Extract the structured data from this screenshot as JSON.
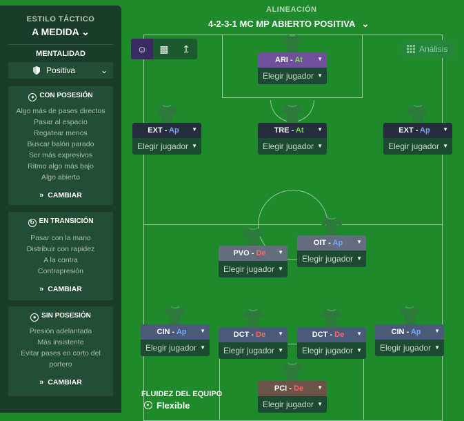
{
  "sidebar": {
    "style_label": "ESTILO TÁCTICO",
    "style_value": "A MEDIDA",
    "mentality_label": "MENTALIDAD",
    "mentality_value": "Positiva",
    "panels": [
      {
        "title": "CON POSESIÓN",
        "items": [
          "Algo más de pases directos",
          "Pasar al espacio",
          "Regatear menos",
          "Buscar balón parado",
          "Ser más expresivos",
          "Ritmo algo más bajo",
          "Algo abierto"
        ],
        "button": "CAMBIAR"
      },
      {
        "title": "EN TRANSICIÓN",
        "items": [
          "Pasar con la mano",
          "Distribuir con rapidez",
          "A la contra",
          "Contrapresión"
        ],
        "button": "CAMBIAR"
      },
      {
        "title": "SIN POSESIÓN",
        "items": [
          "Presión adelantada",
          "Más insistente",
          "Evitar pases en corto del",
          "portero"
        ],
        "button": "CAMBIAR"
      }
    ]
  },
  "header": {
    "title": "ALINEACIÓN",
    "formation": "4-2-3-1 MC MP ABIERTO POSITIVA"
  },
  "toolbar": {
    "analysis_label": "Análisis"
  },
  "players": [
    {
      "role": "ARI",
      "duty": "At",
      "pick": "Elegir jugador",
      "color": "#6f4f9e"
    },
    {
      "role": "EXT",
      "duty": "Ap",
      "pick": "Elegir jugador",
      "color": "#262d3d"
    },
    {
      "role": "TRE",
      "duty": "At",
      "pick": "Elegir jugador",
      "color": "#262d3d"
    },
    {
      "role": "EXT",
      "duty": "Ap",
      "pick": "Elegir jugador",
      "color": "#262d3d"
    },
    {
      "role": "PVO",
      "duty": "De",
      "pick": "Elegir jugador",
      "color": "#646d7d"
    },
    {
      "role": "OIT",
      "duty": "Ap",
      "pick": "Elegir jugador",
      "color": "#646d7d"
    },
    {
      "role": "CIN",
      "duty": "Ap",
      "pick": "Elegir jugador",
      "color": "#4a5a78"
    },
    {
      "role": "DCT",
      "duty": "De",
      "pick": "Elegir jugador",
      "color": "#4a5a78"
    },
    {
      "role": "DCT",
      "duty": "De",
      "pick": "Elegir jugador",
      "color": "#4a5a78"
    },
    {
      "role": "CIN",
      "duty": "Ap",
      "pick": "Elegir jugador",
      "color": "#4a5a78"
    },
    {
      "role": "PCI",
      "duty": "De",
      "pick": "Elegir jugador",
      "color": "#6a5448"
    }
  ],
  "fluidity": {
    "label": "FLUIDEZ DEL EQUIPO",
    "value": "Flexible"
  }
}
